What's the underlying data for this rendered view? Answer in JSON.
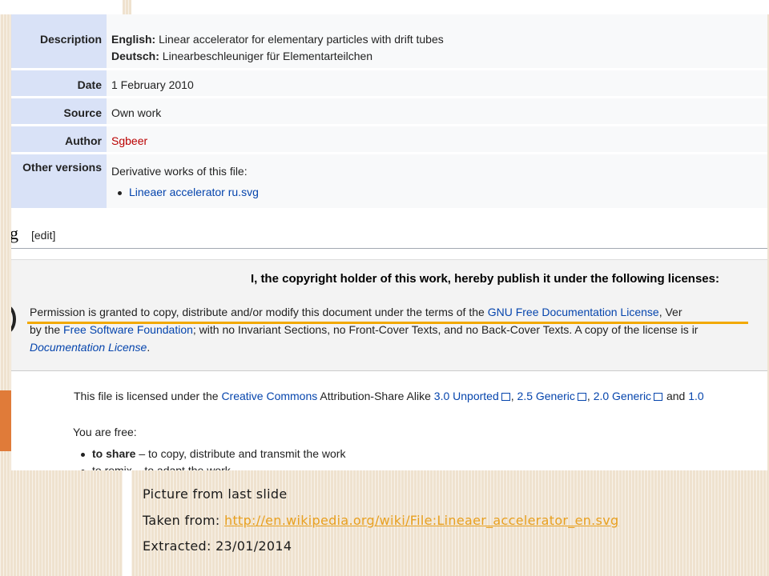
{
  "info": {
    "description_label": "Description",
    "description_en": "Linear accelerator for elementary particles with drift tubes",
    "description_en_prefix": "English:",
    "description_de": "Linearbeschleuniger für Elementarteilchen",
    "description_de_prefix": "Deutsch:",
    "date_label": "Date",
    "date_value": "1 February 2010",
    "source_label": "Source",
    "source_value": "Own work",
    "author_label": "Author",
    "author_value": "Sgbeer",
    "other_label": "Other versions",
    "other_intro": "Derivative works of this file:",
    "other_item": "Lineaer accelerator ru.svg"
  },
  "heading": {
    "tail": "g",
    "edit": "[edit]"
  },
  "license": {
    "header": "I, the copyright holder of this work, hereby publish it under the following licenses:",
    "line1_a": "Permission is granted to copy, distribute and/or modify this document under the terms of the ",
    "line1_link": "GNU Free Documentation License",
    "line1_b": ", Ver",
    "line2_a": "by the ",
    "line2_link": "Free Software Foundation",
    "line2_b": "; with no Invariant Sections, no Front-Cover Texts, and no Back-Cover Texts. A copy of the license is ir",
    "line3_link": "Documentation License",
    "line3_b": "."
  },
  "cc": {
    "intro": "This file is licensed under the ",
    "cc_link": "Creative Commons",
    "attr": " Attribution-Share Alike ",
    "v30": "3.0 Unported",
    "sep1": ", ",
    "v25": "2.5 Generic",
    "sep2": ", ",
    "v20": "2.0 Generic",
    "and": " and ",
    "v10": "1.0",
    "free": "You are free:",
    "share_bold": "to share",
    "share_rest": " – to copy, distribute and transmit the work",
    "cutoff": "to remix – to adapt the work"
  },
  "caption": {
    "line1": "Picture from last slide",
    "taken_prefix": "Taken from: ",
    "url": "http://en.wikipedia.org/wiki/File:Lineaer_accelerator_en.svg",
    "extracted": "Extracted: 23/01/2014"
  },
  "colors": {
    "background": "#efe2cf",
    "accent_orange": "#e07b39",
    "link_caption": "#e8a020",
    "wiki_link": "#0645ad",
    "highlight": "#f2a900"
  }
}
